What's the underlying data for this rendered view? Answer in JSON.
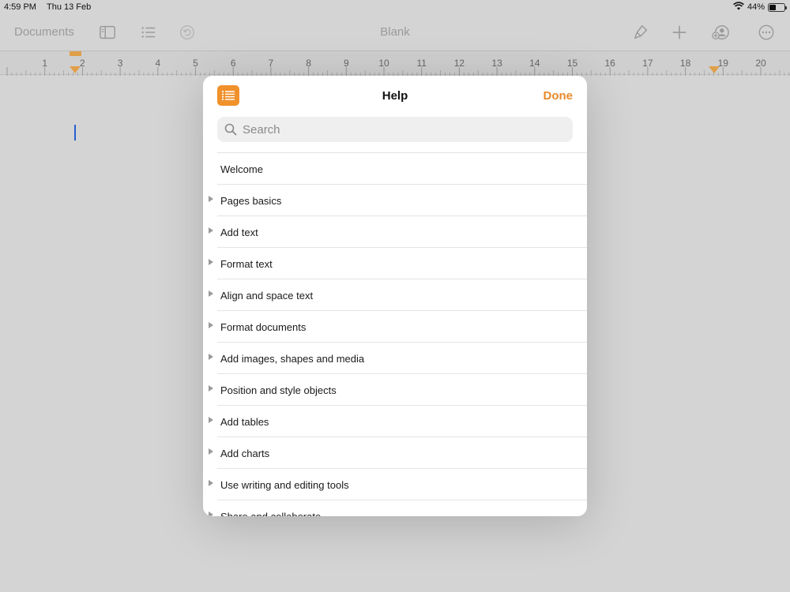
{
  "status": {
    "time": "4:59 PM",
    "date": "Thu 13 Feb",
    "battery": "44%",
    "battery_level": 0.44
  },
  "toolbar": {
    "documents_label": "Documents",
    "doc_title": "Blank",
    "icons": [
      "sidebar-icon",
      "list-icon",
      "undo-icon",
      "paintbrush-icon",
      "plus-icon",
      "collaborate-icon",
      "more-icon"
    ]
  },
  "ruler": {
    "numbers": [
      "1",
      "2",
      "3",
      "4",
      "5",
      "6",
      "7",
      "8",
      "9",
      "10",
      "11",
      "12",
      "13",
      "14",
      "15",
      "16",
      "17",
      "18",
      "19",
      "20"
    ],
    "marker_color": "#e0a04a"
  },
  "help": {
    "title": "Help",
    "done_label": "Done",
    "search_placeholder": "Search",
    "accent_color": "#f0912c",
    "items": [
      {
        "label": "Welcome",
        "expandable": false
      },
      {
        "label": "Pages basics",
        "expandable": true
      },
      {
        "label": "Add text",
        "expandable": true
      },
      {
        "label": "Format text",
        "expandable": true
      },
      {
        "label": "Align and space text",
        "expandable": true
      },
      {
        "label": "Format documents",
        "expandable": true
      },
      {
        "label": "Add images, shapes and media",
        "expandable": true
      },
      {
        "label": "Position and style objects",
        "expandable": true
      },
      {
        "label": "Add tables",
        "expandable": true
      },
      {
        "label": "Add charts",
        "expandable": true
      },
      {
        "label": "Use writing and editing tools",
        "expandable": true
      },
      {
        "label": "Share and collaborate",
        "expandable": true
      }
    ]
  }
}
